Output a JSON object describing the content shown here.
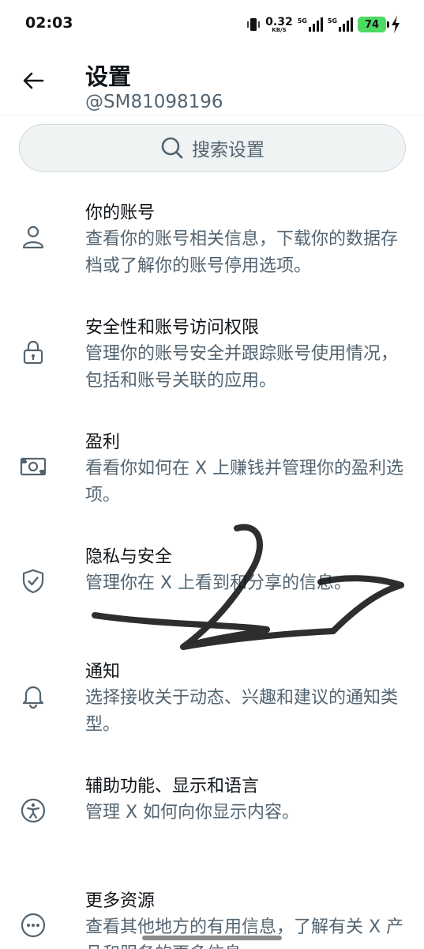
{
  "status_bar": {
    "time": "02:03",
    "net_speed": "0.32",
    "net_speed_unit": "KB/S",
    "sim1_label": "5G",
    "sim2_label": "5G",
    "battery_level": "74",
    "battery_color": "#4cd964"
  },
  "header": {
    "title": "设置",
    "handle": "@SM81098196"
  },
  "search": {
    "label": "搜索设置"
  },
  "settings": [
    {
      "icon": "person-icon",
      "title": "你的账号",
      "desc": "查看你的账号相关信息，下载你的数据存档或了解你的账号停用选项。"
    },
    {
      "icon": "lock-icon",
      "title": "安全性和账号访问权限",
      "desc": "管理你的账号安全并跟踪账号使用情况，包括和账号关联的应用。"
    },
    {
      "icon": "money-icon",
      "title": "盈利",
      "desc": "看看你如何在 X 上赚钱并管理你的盈利选项。"
    },
    {
      "icon": "shield-icon",
      "title": "隐私与安全",
      "desc": "管理你在 X 上看到和分享的信息。"
    },
    {
      "icon": "bell-icon",
      "title": "通知",
      "desc": "选择接收关于动态、兴趣和建议的通知类型。"
    },
    {
      "icon": "accessibility-icon",
      "title": "辅助功能、显示和语言",
      "desc": "管理 X 如何向你显示内容。"
    },
    {
      "icon": "more-icon",
      "title": "更多资源",
      "desc": "查看其他地方的有用信息，了解有关 X 产品和服务的更多信息。"
    }
  ],
  "colors": {
    "text_primary": "#0f1419",
    "text_secondary": "#536471",
    "search_bg": "#eff3f4",
    "divider": "#eff3f4"
  }
}
